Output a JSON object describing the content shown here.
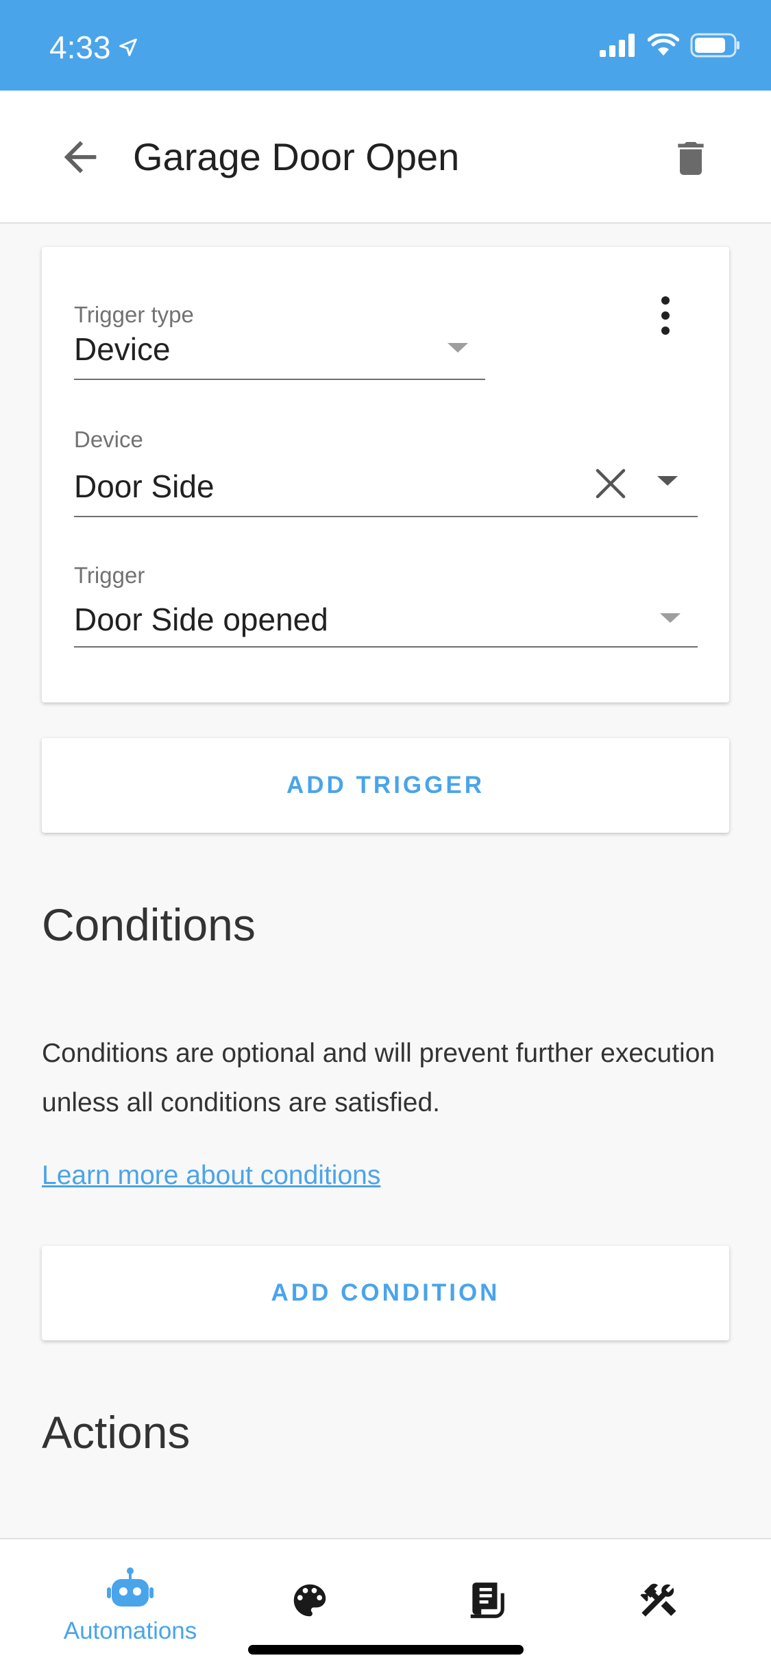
{
  "status_bar": {
    "time": "4:33"
  },
  "header": {
    "title": "Garage Door Open"
  },
  "trigger_card": {
    "trigger_type": {
      "label": "Trigger type",
      "value": "Device"
    },
    "device": {
      "label": "Device",
      "value": "Door Side"
    },
    "trigger": {
      "label": "Trigger",
      "value": "Door Side opened"
    }
  },
  "add_trigger_label": "ADD TRIGGER",
  "conditions": {
    "title": "Conditions",
    "description": "Conditions are optional and will prevent further execution unless all conditions are satisfied.",
    "learn_more": "Learn more about conditions",
    "add_label": "ADD CONDITION"
  },
  "actions": {
    "title": "Actions"
  },
  "bottom_nav": {
    "items": [
      {
        "label": "Automations",
        "icon": "robot-icon",
        "active": true
      },
      {
        "label": "",
        "icon": "palette-icon"
      },
      {
        "label": "",
        "icon": "logbook-icon"
      },
      {
        "label": "",
        "icon": "tools-icon"
      }
    ]
  },
  "colors": {
    "accent": "#4aa4ea",
    "status_bar": "#4aa4ea"
  }
}
